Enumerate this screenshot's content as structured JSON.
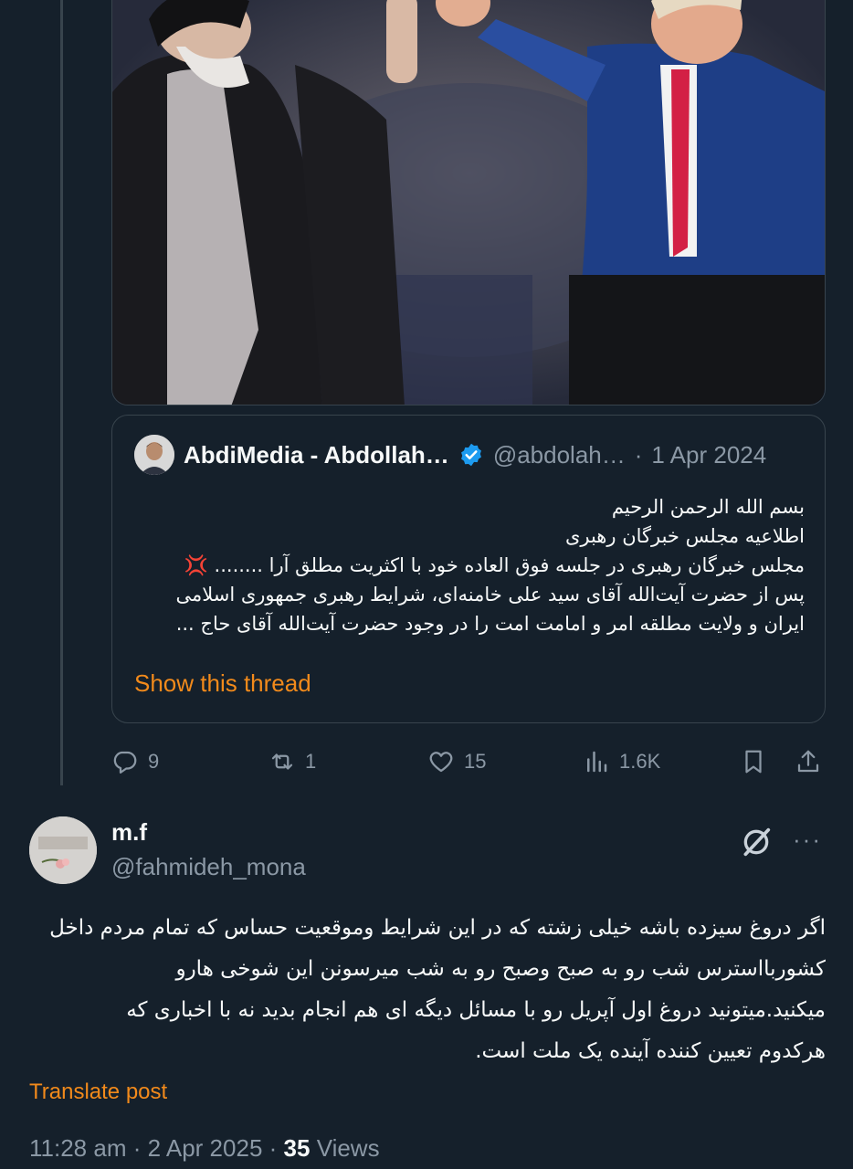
{
  "quoted_tweet": {
    "author_name": "AbdiMedia - Abdollah…",
    "handle": "@abdolah…",
    "separator": "·",
    "date": "1 Apr 2024",
    "text_lines": [
      "بسم الله الرحمن الرحیم",
      "اطلاعیه مجلس خبرگان رهبری",
      "مجلس خبرگان رهبری در جلسه فوق العاده خود با اکثریت مطلق آرا ........",
      "پس از حضرت آیت‌الله آقای سید علی خامنه‌ای، شرایط رهبری جمهوری اسلامی",
      "ایران و ولایت مطلقه امر و امامت امت را در وجود حضرت آیت‌الله آقای حاج ..."
    ],
    "emoji": "💢",
    "show_thread": "Show this thread"
  },
  "actions": {
    "replies": "9",
    "reposts": "1",
    "likes": "15",
    "views": "1.6K"
  },
  "reply": {
    "name": "m.f",
    "handle": "@fahmideh_mona",
    "text_lines": [
      "اگر دروغ سیزده باشه خیلی زشته که در  این شرایط وموقعیت حساس که تمام مردم داخل",
      "کشوربااسترس شب رو  به صبح وصبح رو به شب میرسونن این شوخی هارو",
      "میکنید.میتونید دروغ اول آپریل رو  با مسائل دیگه ای هم انجام بدید نه با اخباری که",
      "هرکدوم  تعیین کننده آینده یک ملت است."
    ],
    "translate": "Translate post",
    "time": "11:28 am",
    "date": "2 Apr 2025",
    "views_count": "35",
    "views_label": "Views",
    "dot": "·",
    "more": "···"
  },
  "colors": {
    "background": "#15202b",
    "accent": "#f28a1b",
    "muted": "#8b98a5",
    "verified": "#1d9bf0"
  }
}
